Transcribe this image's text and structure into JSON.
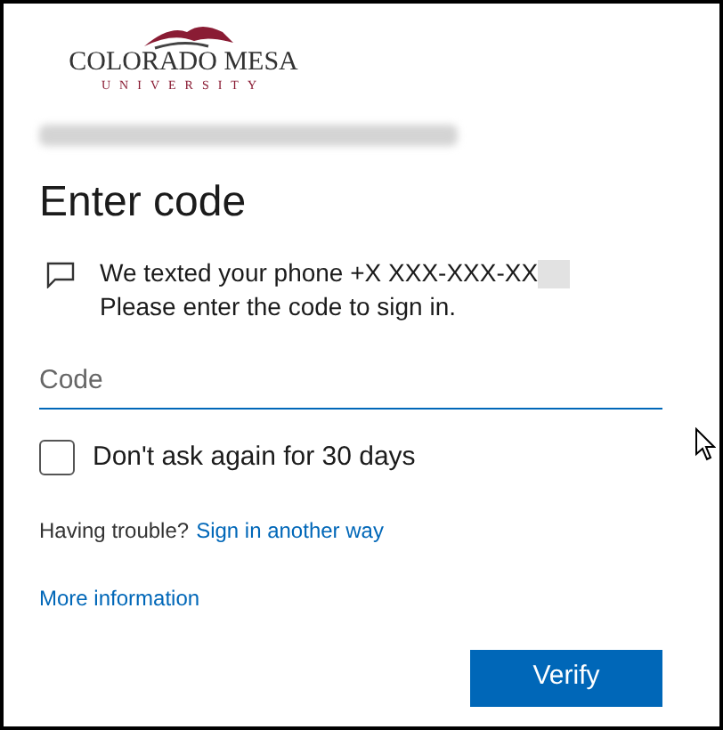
{
  "logo": {
    "name": "COLORADO MESA",
    "subtitle": "UNIVERSITY"
  },
  "title": "Enter code",
  "message": {
    "line_1": "We texted your phone +X XXX-XXX-XX",
    "line_2": "Please enter the code to sign in."
  },
  "code_field": {
    "placeholder": "Code"
  },
  "remember": {
    "label": "Don't ask again for 30 days",
    "checked": false
  },
  "trouble": {
    "text": "Having trouble?",
    "link": "Sign in another way"
  },
  "more_info": "More information",
  "buttons": [
    "Verify"
  ]
}
